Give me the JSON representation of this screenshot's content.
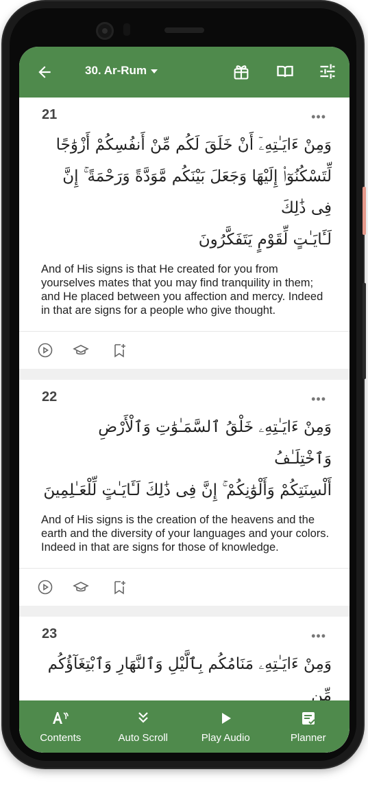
{
  "appbar": {
    "title": "30. Ar-Rum",
    "icons": [
      "back-arrow-icon",
      "gift-icon",
      "book-icon",
      "tune-icon"
    ]
  },
  "verses": [
    {
      "number": "21",
      "arabic_lines": [
        "وَمِنْ ءَايَـٰتِهِۦٓ أَنْ خَلَقَ لَكُم مِّنْ أَنفُسِكُمْ أَزْوَٰجًا",
        "لِّتَسْكُنُوٓا۟ إِلَيْهَا وَجَعَلَ بَيْنَكُم مَّوَدَّةً وَرَحْمَةً ۚ إِنَّ فِى ذَٰلِكَ",
        "لَـَٔايَـٰتٍ لِّقَوْمٍ يَتَفَكَّرُونَ"
      ],
      "translation": "And of His signs is that He created for you from yourselves mates that you may find tranquility in them; and He placed between you affection and mercy. Indeed in that are signs for a people who give thought."
    },
    {
      "number": "22",
      "arabic_lines": [
        "وَمِنْ ءَايَـٰتِهِۦ خَلْقُ ٱلسَّمَـٰوَٰتِ وَٱلْأَرْضِ وَٱخْتِلَـٰفُ",
        "أَلْسِنَتِكُمْ وَأَلْوَٰنِكُمْ ۚ إِنَّ فِى ذَٰلِكَ لَـَٔايَـٰتٍ لِّلْعَـٰلِمِينَ"
      ],
      "translation": "And of His signs is the creation of the heavens and the earth and the diversity of your languages and your colors. Indeed in that are signs for those of knowledge."
    },
    {
      "number": "23",
      "arabic_lines": [
        "وَمِنْ ءَايَـٰتِهِۦ مَنَامُكُم بِٱلَّيْلِ وَٱلنَّهَارِ وَٱبْتِغَآؤُكُم مِّن"
      ],
      "translation": ""
    }
  ],
  "more_label": "•••",
  "bottom_nav": [
    {
      "label": "Contents",
      "icon": "contents-icon"
    },
    {
      "label": "Auto Scroll",
      "icon": "auto-scroll-icon"
    },
    {
      "label": "Play Audio",
      "icon": "play-icon"
    },
    {
      "label": "Planner",
      "icon": "planner-icon"
    }
  ],
  "colors": {
    "primary": "#4f8a4c",
    "tajweed_green": "#4f9a3a",
    "tajweed_pink": "#c44bb8",
    "tajweed_orange": "#e08a2a"
  }
}
